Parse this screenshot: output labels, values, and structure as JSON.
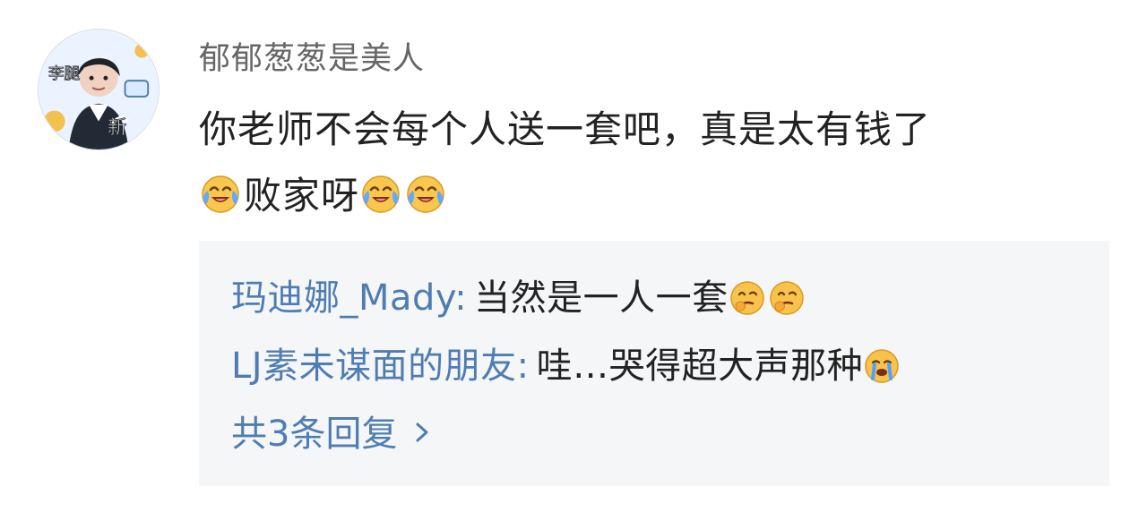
{
  "comment": {
    "avatar": {
      "alt_icon": "user-avatar",
      "lettering": [
        "李",
        "腿",
        "新"
      ]
    },
    "username": "郁郁葱葱是美人",
    "text_line_1": "你老师不会每个人送一套吧，真是太有钱了",
    "text_line_2": "败家呀",
    "emoji_names": [
      "laugh-cry-emoji",
      "laugh-cry-emoji",
      "laugh-cry-emoji"
    ]
  },
  "replies": {
    "items": [
      {
        "user": "玛迪娜_Mady",
        "separator": ":",
        "text": "当然是一人一套",
        "emoji_names": [
          "thinking-emoji",
          "thinking-emoji"
        ]
      },
      {
        "user": "LJ素未谋面的朋友",
        "separator": ":",
        "text": "哇…哭得超大声那种",
        "emoji_names": [
          "crying-emoji"
        ]
      }
    ],
    "more_label": "共3条回复",
    "more_icon": "chevron-right-icon"
  },
  "colors": {
    "link_blue": "#4f7db2",
    "reply_bg": "#f5f6f8",
    "text_main": "#222222",
    "text_secondary": "#666666"
  }
}
